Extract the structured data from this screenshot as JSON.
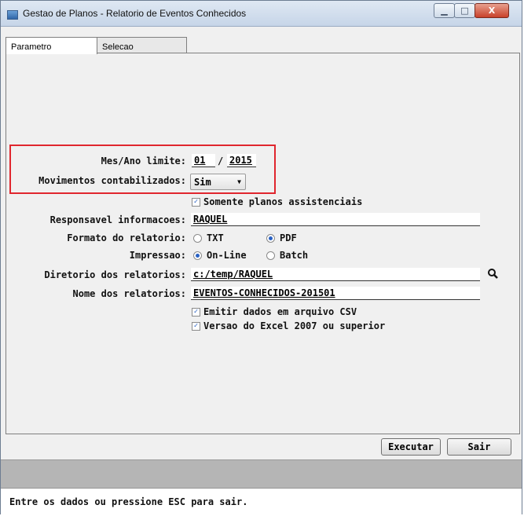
{
  "window": {
    "title": "Gestao de Planos - Relatorio de Eventos Conhecidos",
    "minimize_icon": "minimize-icon",
    "maximize_icon": "maximize-icon",
    "close_icon": "close-icon"
  },
  "tabs": [
    {
      "label": "Parametro"
    },
    {
      "label": "Selecao"
    }
  ],
  "form": {
    "mes_ano_label": "Mes/Ano limite:",
    "mes_value": "01",
    "slash": "/",
    "ano_value": "2015",
    "movimentos_label": "Movimentos contabilizados:",
    "movimentos_value": "Sim",
    "somente_planos_label": "Somente planos assistenciais",
    "responsavel_label": "Responsavel informacoes:",
    "responsavel_value": "RAQUEL",
    "formato_label": "Formato do relatorio:",
    "formato_options": [
      "TXT",
      "PDF"
    ],
    "formato_selected": "PDF",
    "impressao_label": "Impressao:",
    "impressao_options": [
      "On-Line",
      "Batch"
    ],
    "impressao_selected": "On-Line",
    "diretorio_label": "Diretorio dos relatorios:",
    "diretorio_value": "c:/temp/RAQUEL",
    "nome_label": "Nome dos relatorios:",
    "nome_value": "EVENTOS-CONHECIDOS-201501",
    "emitir_csv_label": "Emitir dados em arquivo CSV",
    "versao_excel_label": "Versao do Excel 2007 ou superior"
  },
  "buttons": {
    "executar": "Executar",
    "sair": "Sair"
  },
  "status": {
    "message": "Entre os dados ou pressione ESC para sair."
  },
  "colors": {
    "highlight_border": "#e0262e",
    "accent": "#2a62c4"
  }
}
